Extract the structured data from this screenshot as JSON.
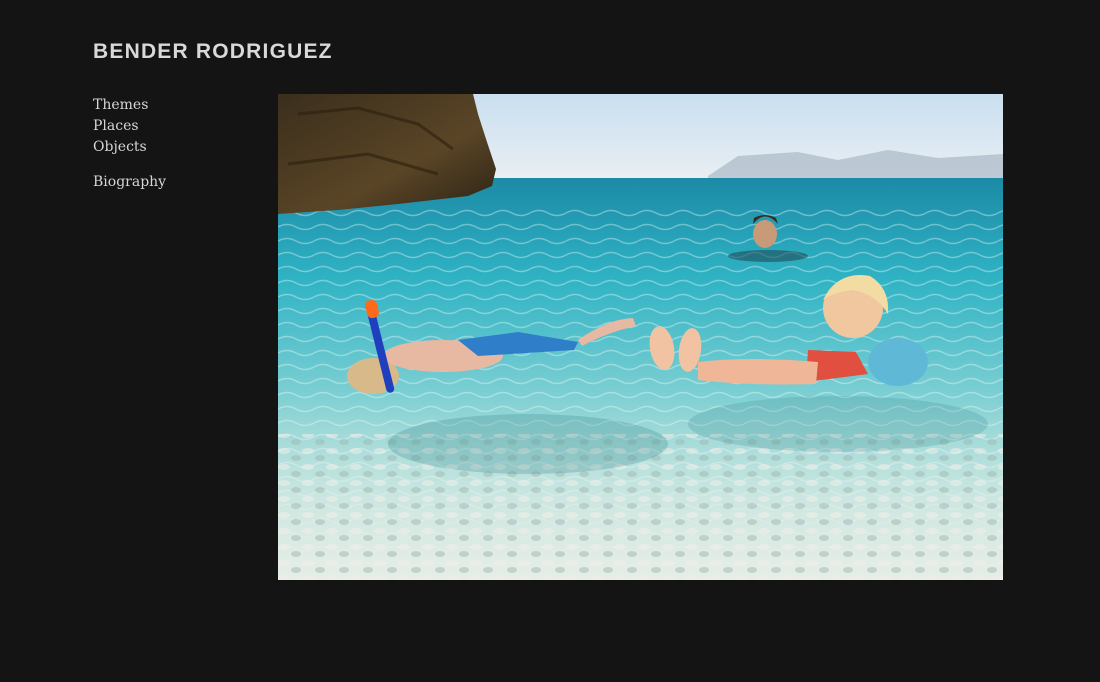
{
  "site": {
    "title": "BENDER RODRIGUEZ"
  },
  "nav": {
    "items": [
      {
        "label": "Themes"
      },
      {
        "label": "Places"
      },
      {
        "label": "Objects"
      }
    ],
    "secondary": [
      {
        "label": "Biography"
      }
    ]
  },
  "photo": {
    "alt": "Children and a woman swimming in clear turquoise sea water near a rocky cliff"
  },
  "colors": {
    "background": "#141414",
    "text": "#d9d9d9"
  }
}
